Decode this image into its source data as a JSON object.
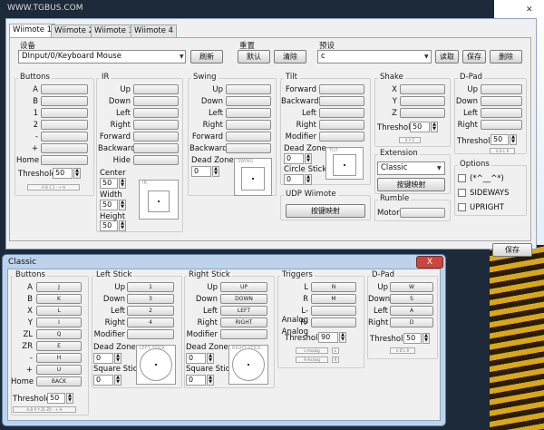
{
  "desktop": {
    "watermark": "WWW.TGBUS.COM"
  },
  "main": {
    "tabs": [
      "Wiimote 1",
      "Wiimote 2",
      "Wiimote 3",
      "Wiimote 4"
    ],
    "device": {
      "label": "设备",
      "value": "DInput/0/Keyboard Mouse",
      "refresh": "刷新"
    },
    "reset": {
      "label": "重置",
      "default": "默认",
      "clear": "清除"
    },
    "preset": {
      "label": "预设",
      "value": "c",
      "load": "读取",
      "save": "保存",
      "delete": "删除"
    },
    "buttons": {
      "title": "Buttons",
      "rows": [
        "A",
        "B",
        "1",
        "2",
        "-",
        "+",
        "Home"
      ],
      "threshold_label": "Threshold",
      "threshold": "50",
      "hint": "A B 1 2 - + H"
    },
    "ir": {
      "title": "IR",
      "rows": [
        "Up",
        "Down",
        "Left",
        "Right",
        "Forward",
        "Backward",
        "Hide"
      ],
      "center_label": "Center",
      "center": "50",
      "width_label": "Width",
      "width": "50",
      "height_label": "Height",
      "height": "50",
      "stick_title": "IR"
    },
    "swing": {
      "title": "Swing",
      "rows": [
        "Up",
        "Down",
        "Left",
        "Right",
        "Forward",
        "Backward"
      ],
      "deadzone_label": "Dead Zone",
      "deadzone": "0",
      "stick_title": "SWING"
    },
    "tilt": {
      "title": "Tilt",
      "rows": [
        "Forward",
        "Backward",
        "Left",
        "Right",
        "Modifier"
      ],
      "deadzone_label": "Dead Zone",
      "deadzone": "0",
      "circle_label": "Circle Stick",
      "circle": "0",
      "stick_title": "TILT"
    },
    "udp": {
      "title": "UDP Wiimote",
      "button": "按键映射"
    },
    "shake": {
      "title": "Shake",
      "rows": [
        "X",
        "Y",
        "Z"
      ],
      "threshold_label": "Threshold",
      "threshold": "50",
      "hint": "X Y Z"
    },
    "extension": {
      "title": "Extension",
      "value": "Classic",
      "button": "按键映射"
    },
    "rumble": {
      "title": "Rumble",
      "motor_label": "Motor"
    },
    "dpad": {
      "title": "D-Pad",
      "rows": [
        "Up",
        "Down",
        "Left",
        "Right"
      ],
      "threshold_label": "Threshold",
      "threshold": "50",
      "hint": "U D L R"
    },
    "options": {
      "title": "Options",
      "items": [
        "(*^__^*)",
        "SIDEWAYS",
        "UPRIGHT"
      ]
    },
    "save": "保存"
  },
  "classic": {
    "title": "Classic",
    "close": "X",
    "buttons": {
      "title": "Buttons",
      "rows": [
        {
          "l": "A",
          "v": "J"
        },
        {
          "l": "B",
          "v": "K"
        },
        {
          "l": "X",
          "v": "L"
        },
        {
          "l": "Y",
          "v": "I"
        },
        {
          "l": "ZL",
          "v": "Q"
        },
        {
          "l": "ZR",
          "v": "E"
        },
        {
          "l": "-",
          "v": "H"
        },
        {
          "l": "+",
          "v": "U"
        },
        {
          "l": "Home",
          "v": "BACK"
        }
      ],
      "threshold_label": "Threshold",
      "threshold": "50",
      "hint": "A B X Y ZL ZR - + H"
    },
    "left_stick": {
      "title": "Left Stick",
      "rows": [
        {
          "l": "Up",
          "v": "1"
        },
        {
          "l": "Down",
          "v": "3"
        },
        {
          "l": "Left",
          "v": "2"
        },
        {
          "l": "Right",
          "v": "4"
        },
        {
          "l": "Modifier",
          "v": ""
        }
      ],
      "deadzone_label": "Dead Zone",
      "deadzone": "0",
      "square_label": "Square Stick",
      "square": "0",
      "stick_title": "LEFT STICK"
    },
    "right_stick": {
      "title": "Right Stick",
      "rows": [
        {
          "l": "Up",
          "v": "UP"
        },
        {
          "l": "Down",
          "v": "DOWN"
        },
        {
          "l": "Left",
          "v": "LEFT"
        },
        {
          "l": "Right",
          "v": "RIGHT"
        },
        {
          "l": "Modifier",
          "v": ""
        }
      ],
      "deadzone_label": "Dead Zone",
      "deadzone": "0",
      "square_label": "Square Stick",
      "square": "0",
      "stick_title": "RIGHT STICK"
    },
    "triggers": {
      "title": "Triggers",
      "rows": [
        {
          "l": "L",
          "v": "N"
        },
        {
          "l": "R",
          "v": "M"
        },
        {
          "l": "L-Analog",
          "v": ""
        },
        {
          "l": "R-Analog",
          "v": ""
        }
      ],
      "threshold_label": "Threshold",
      "threshold": "90",
      "hint1": "L-Analog",
      "hint2": "R-Analog",
      "hint1b": "L",
      "hint2b": "R"
    },
    "dpad": {
      "title": "D-Pad",
      "rows": [
        {
          "l": "Up",
          "v": "W"
        },
        {
          "l": "Down",
          "v": "S"
        },
        {
          "l": "Left",
          "v": "A"
        },
        {
          "l": "Right",
          "v": "D"
        }
      ],
      "threshold_label": "Threshold",
      "threshold": "50",
      "hint": "U D L R"
    }
  },
  "right_save": "保存"
}
